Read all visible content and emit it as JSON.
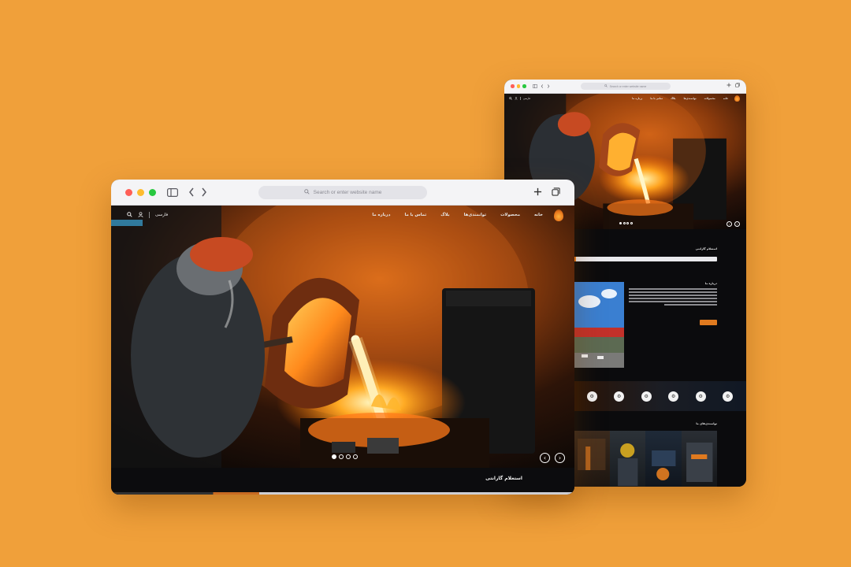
{
  "colors": {
    "background": "#f0a03a",
    "accent": "#e07a1f",
    "site_bg": "#0b0b0d"
  },
  "front_browser": {
    "address_placeholder": "Search or enter website name",
    "nav": {
      "language": "فارسی",
      "menu": [
        "خانه",
        "محصولات",
        "توانمندی‌ها",
        "بلاگ",
        "تماس با ما",
        "درباره ما"
      ]
    },
    "slider": {
      "dot_count": 4,
      "active_index": 0
    },
    "warranty_title": "استعلام گارانتی"
  },
  "back_browser": {
    "address_placeholder": "Search or enter website name",
    "nav": {
      "language": "فارسی",
      "menu": [
        "خانه",
        "محصولات",
        "توانمندی‌ها",
        "بلاگ",
        "تماس با ما",
        "درباره ما"
      ]
    },
    "inquiry_title": "استعلام گارانتی",
    "about_title": "درباره ما",
    "gallery_title": "توانمندی‌های ما"
  }
}
